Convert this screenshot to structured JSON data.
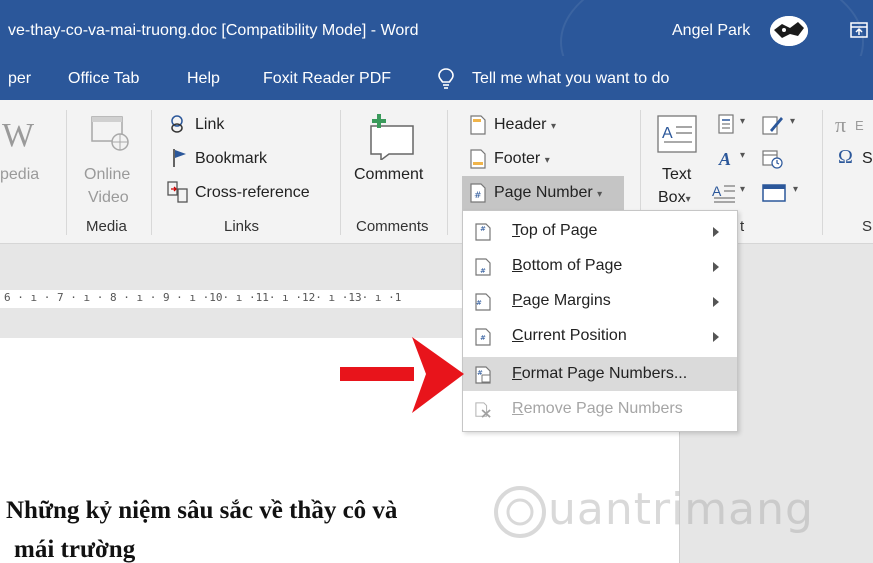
{
  "window": {
    "title": "ve-thay-co-va-mai-truong.doc [Compatibility Mode]  -  Word",
    "user_name": "Angel Park"
  },
  "menu": {
    "items": [
      "per",
      "Office Tab",
      "Help",
      "Foxit Reader PDF"
    ],
    "tell_me": "Tell me what you want to do"
  },
  "ribbon": {
    "wikipedia_partial": "pedia",
    "online_video_line1": "Online",
    "online_video_line2": "Video",
    "link": "Link",
    "bookmark": "Bookmark",
    "cross_reference": "Cross-reference",
    "comment": "Comment",
    "header": "Header",
    "footer": "Footer",
    "page_number": "Page Number",
    "text_box_line1": "Text",
    "text_box_line2": "Box",
    "groups": {
      "media": "Media",
      "links": "Links",
      "comments": "Comments",
      "text_partial": "t",
      "symbols_partial": "S"
    },
    "equation_partial": "E",
    "symbol_partial": "S"
  },
  "ruler": {
    "ticks": "6 · ı · 7 · ı · 8 · ı · 9 · ı ·10· ı ·11· ı ·12· ı ·13· ı ·1"
  },
  "dropdown": {
    "items": [
      {
        "accel": "T",
        "rest": "op of Page",
        "submenu": true,
        "state": "normal"
      },
      {
        "accel": "B",
        "rest": "ottom of Page",
        "submenu": true,
        "state": "normal"
      },
      {
        "accel": "P",
        "rest": "age Margins",
        "submenu": true,
        "state": "normal"
      },
      {
        "accel": "C",
        "rest": "urrent Position",
        "submenu": true,
        "state": "normal"
      },
      {
        "accel": "F",
        "rest": "ormat Page Numbers...",
        "submenu": false,
        "state": "highlighted"
      },
      {
        "accel": "R",
        "rest": "emove Page Numbers",
        "submenu": false,
        "state": "disabled"
      }
    ]
  },
  "document": {
    "heading_line1": "Những kỷ niệm sâu sắc về thầy cô và",
    "heading_line2": "mái trường"
  },
  "watermark": {
    "text": "uantrimang"
  },
  "colors": {
    "title_bar": "#2b579a",
    "ribbon_bg": "#f3f3f3",
    "highlight": "#dadada",
    "annotation_arrow": "#e8141b"
  }
}
